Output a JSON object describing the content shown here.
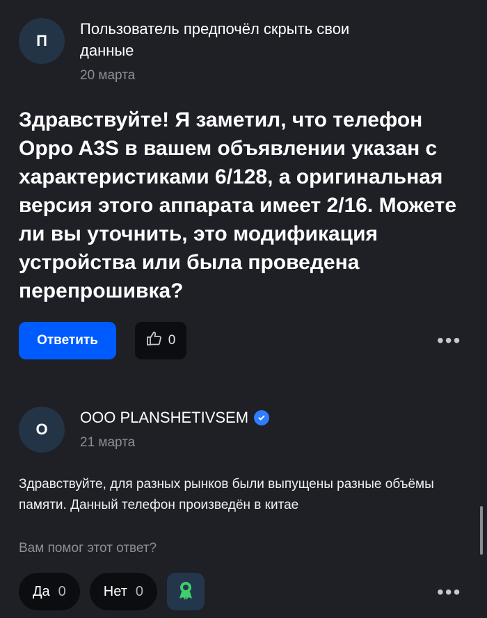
{
  "question": {
    "avatar_letter": "П",
    "author": "Пользователь предпочёл скрыть свои данные",
    "date": "20 марта",
    "text": "Здравствуйте! Я заметил, что телефон Oppo A3S в вашем объявлении указан с характеристиками 6/128, а оригинальная версия этого аппарата имеет 2/16. Можете ли вы уточнить, это модификация устройства или была проведена перепрошивка?",
    "reply_label": "Ответить",
    "likes": "0",
    "more_label": "•••"
  },
  "answer": {
    "avatar_letter": "О",
    "author": "ООО PLANSHETIVSEM",
    "date": "21 марта",
    "text": "Здравствуйте, для разных рынков были выпущены разные объёмы памяти. Данный телефон произведён в китае",
    "helped_prompt": "Вам помог этот ответ?",
    "yes_label": "Да",
    "yes_count": "0",
    "no_label": "Нет",
    "no_count": "0",
    "more_label": "•••"
  },
  "colors": {
    "background": "#1f2026",
    "accent": "#005bff",
    "verified": "#2f7cff",
    "badge_green": "#3fcf6b"
  },
  "icons": [
    "thumb-up-icon",
    "verified-check-icon",
    "award-ribbon-icon",
    "more-dots-icon"
  ]
}
